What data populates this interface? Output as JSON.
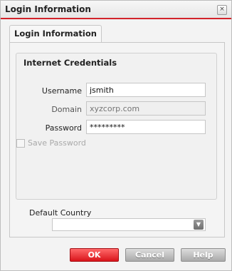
{
  "window": {
    "title": "Login Information",
    "close_glyph": "×"
  },
  "tabs": [
    {
      "label": "Login Information",
      "selected": true
    }
  ],
  "credentials": {
    "group_title": "Internet Credentials",
    "username": {
      "label": "Username",
      "value": "jsmith"
    },
    "domain": {
      "label": "Domain",
      "placeholder": "xyzcorp.com",
      "value": ""
    },
    "password": {
      "label": "Password",
      "value": "*********"
    },
    "save_password": {
      "label": "Save Password",
      "checked": false,
      "enabled": false
    }
  },
  "country": {
    "label": "Default Country",
    "selected": "",
    "arrow_glyph": "▼"
  },
  "buttons": {
    "ok": "OK",
    "cancel": "Cancel",
    "help": "Help"
  },
  "colors": {
    "accent": "#d2232a",
    "ok_button": "#d9141b",
    "secondary_button": "#a9a9a9"
  }
}
